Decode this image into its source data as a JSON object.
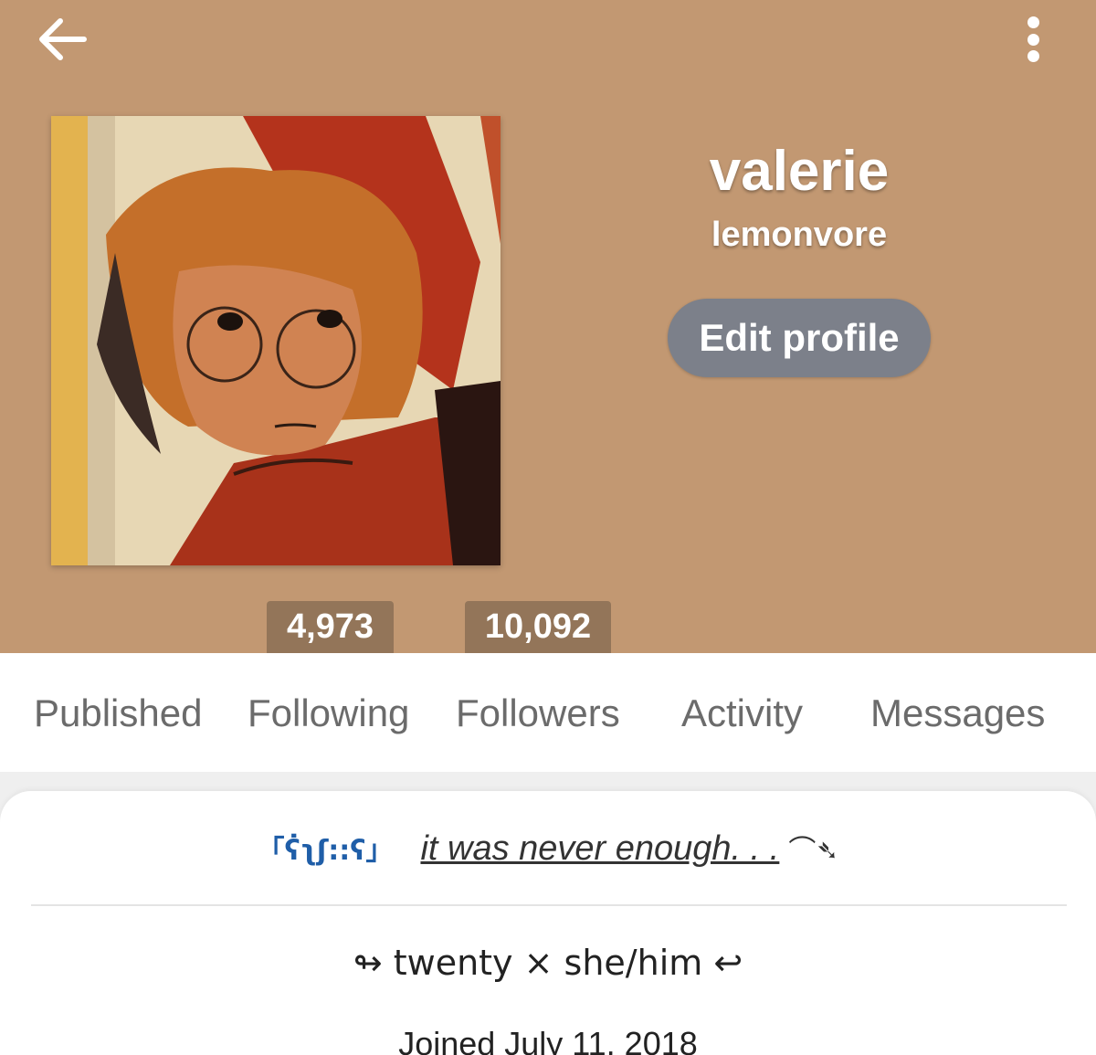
{
  "header": {
    "display_name": "valerie",
    "username": "lemonvore",
    "edit_label": "Edit profile",
    "following_count": "4,973",
    "followers_count": "10,092"
  },
  "icons": {
    "back": "arrow-left-icon",
    "more": "more-vertical-icon"
  },
  "tabs": [
    {
      "label": "Published"
    },
    {
      "label": "Following"
    },
    {
      "label": "Followers"
    },
    {
      "label": "Activity"
    },
    {
      "label": "Messages"
    }
  ],
  "bio": {
    "symbols": "「ʕ̇ʅʃ::ʕ」",
    "tagline": "it was never enough. . .",
    "tagline_arrow": "⌒➴",
    "pronouns": "↬ twenty × she/him ↩",
    "joined": "Joined July 11, 2018"
  },
  "colors": {
    "header_bg": "#c29872",
    "button_bg": "#7c808a",
    "accent_blue": "#1f5ea8"
  }
}
